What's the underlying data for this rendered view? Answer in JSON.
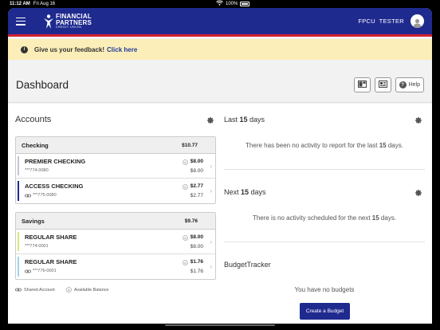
{
  "status_bar": {
    "time": "11:12 AM",
    "date": "Fri Aug 16",
    "battery": "100%"
  },
  "header": {
    "logo_line1": "FINANCIAL",
    "logo_line2": "PARTNERS",
    "logo_line3": "CREDIT UNION",
    "user_name": "FPCU  TESTER",
    "menu_icon": "hamburger-menu-icon",
    "avatar_icon": "user-avatar-icon"
  },
  "feedback": {
    "text": "Give us your feedback!",
    "link": "Click here"
  },
  "page": {
    "title": "Dashboard",
    "help_label": "Help"
  },
  "accounts": {
    "title": "Accounts",
    "groups": [
      {
        "name": "Checking",
        "total": "$10.77",
        "rows": [
          {
            "name": "PREMIER CHECKING",
            "number": "***774-0080",
            "balance": "$8.00",
            "available": "$8.00",
            "shared": false,
            "color": "#c8c2d6"
          },
          {
            "name": "ACCESS CHECKING",
            "number": "***775-0080",
            "balance": "$2.77",
            "available": "$2.77",
            "shared": true,
            "color": "#1f2a8f"
          }
        ]
      },
      {
        "name": "Savings",
        "total": "$9.76",
        "rows": [
          {
            "name": "REGULAR SHARE",
            "number": "***774-0001",
            "balance": "$8.00",
            "available": "$8.00",
            "shared": false,
            "color": "#d8e67a"
          },
          {
            "name": "REGULAR SHARE",
            "number": "***776-0001",
            "balance": "$1.76",
            "available": "$1.76",
            "shared": true,
            "color": "#9bd6f0"
          }
        ]
      }
    ],
    "legend_shared": "Shared Account",
    "legend_available": "Available Balance",
    "legend_symbol": "A"
  },
  "last_days": {
    "label_pre": "Last ",
    "days": "15",
    "label_post": " days",
    "message_pre": "There has been no activity to report for the last ",
    "message_post": " days."
  },
  "next_days": {
    "label_pre": "Next ",
    "days": "15",
    "label_post": " days",
    "message_pre": "There is no activity scheduled for the next ",
    "message_post": " days."
  },
  "budget": {
    "title": "BudgetTracker",
    "message": "You have no budgets",
    "button": "Create a Budget"
  },
  "colors": {
    "brand": "#1f2a8f",
    "accent": "#d11f2e",
    "banner": "#fbeeb8"
  }
}
